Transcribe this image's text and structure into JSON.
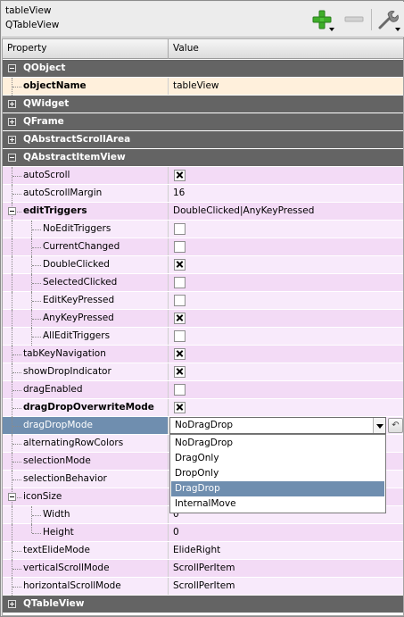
{
  "header": {
    "object_name": "tableView",
    "class_name": "QTableView",
    "add_icon": "green-plus-icon",
    "remove_icon": "minus-icon",
    "config_icon": "wrench-icon"
  },
  "columns": {
    "property": "Property",
    "value": "Value"
  },
  "rows": [
    {
      "type": "group",
      "label": "QObject",
      "expanded": true
    },
    {
      "type": "prop",
      "label": "objectName",
      "value": "tableView",
      "bold": true
    },
    {
      "type": "group",
      "label": "QWidget",
      "expanded": false
    },
    {
      "type": "group",
      "label": "QFrame",
      "expanded": false
    },
    {
      "type": "group",
      "label": "QAbstractScrollArea",
      "expanded": false
    },
    {
      "type": "group",
      "label": "QAbstractItemView",
      "expanded": true
    },
    {
      "type": "prop",
      "label": "autoScroll",
      "checked": true
    },
    {
      "type": "prop",
      "label": "autoScrollMargin",
      "value": "16"
    },
    {
      "type": "prop",
      "label": "editTriggers",
      "value": "DoubleClicked|AnyKeyPressed",
      "bold": true
    },
    {
      "type": "sub",
      "label": "NoEditTriggers",
      "checked": false
    },
    {
      "type": "sub",
      "label": "CurrentChanged",
      "checked": false
    },
    {
      "type": "sub",
      "label": "DoubleClicked",
      "checked": true
    },
    {
      "type": "sub",
      "label": "SelectedClicked",
      "checked": false
    },
    {
      "type": "sub",
      "label": "EditKeyPressed",
      "checked": false
    },
    {
      "type": "sub",
      "label": "AnyKeyPressed",
      "checked": true
    },
    {
      "type": "sub",
      "label": "AllEditTriggers",
      "checked": false
    },
    {
      "type": "prop",
      "label": "tabKeyNavigation",
      "checked": true
    },
    {
      "type": "prop",
      "label": "showDropIndicator",
      "checked": true
    },
    {
      "type": "prop",
      "label": "dragEnabled",
      "checked": false
    },
    {
      "type": "prop",
      "label": "dragDropOverwriteMode",
      "checked": true,
      "bold": true
    },
    {
      "type": "prop",
      "label": "dragDropMode",
      "value": "NoDragDrop",
      "selected": true
    },
    {
      "type": "prop",
      "label": "alternatingRowColors"
    },
    {
      "type": "prop",
      "label": "selectionMode"
    },
    {
      "type": "prop",
      "label": "selectionBehavior"
    },
    {
      "type": "prop",
      "label": "iconSize",
      "value": "",
      "expander": true
    },
    {
      "type": "sub",
      "label": "Width",
      "value": "0"
    },
    {
      "type": "sub",
      "label": "Height",
      "value": "0",
      "last": true
    },
    {
      "type": "prop",
      "label": "textElideMode",
      "value": "ElideRight"
    },
    {
      "type": "prop",
      "label": "verticalScrollMode",
      "value": "ScrollPerItem"
    },
    {
      "type": "prop",
      "label": "horizontalScrollMode",
      "value": "ScrollPerItem"
    },
    {
      "type": "group",
      "label": "QTableView",
      "expanded": false
    }
  ],
  "dropdown": {
    "options": [
      "NoDragDrop",
      "DragOnly",
      "DropOnly",
      "DragDrop",
      "InternalMove"
    ],
    "highlighted": "DragDrop"
  },
  "reset_icon": "reset-arrow-icon"
}
